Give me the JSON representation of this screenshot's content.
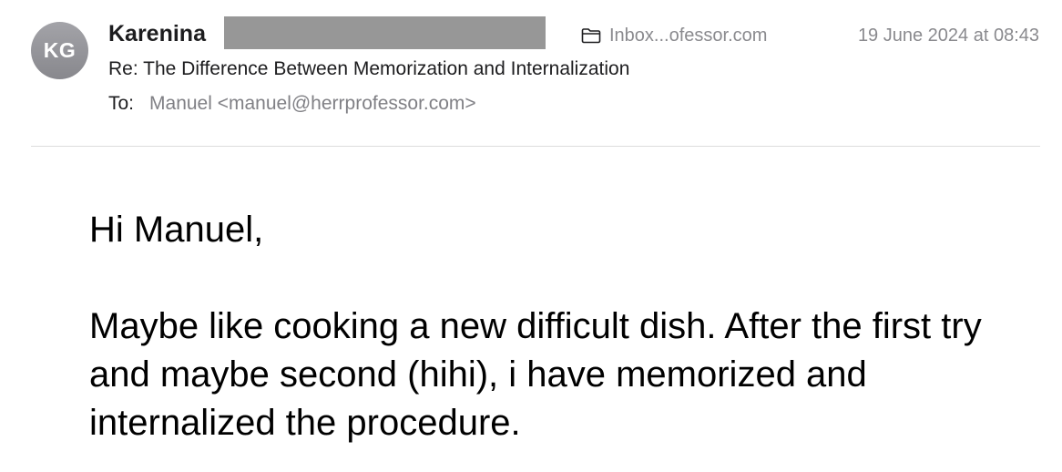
{
  "header": {
    "avatar_initials": "KG",
    "sender_name": "Karenina",
    "mailbox": "Inbox...ofessor.com",
    "mailbox_icon": "folder-icon",
    "date": "19 June 2024 at 08:43",
    "subject": "Re: The Difference Between Memorization and Internalization",
    "to_label": "To:",
    "to_value": "Manuel <manuel@herrprofessor.com>"
  },
  "body": {
    "greeting": "Hi Manuel,",
    "paragraph": "Maybe like cooking a new difficult dish. After the first try and maybe second (hihi), i have memorized and internalized the procedure."
  },
  "colors": {
    "avatar_bg": "#939398",
    "meta_text": "#8a8a8e",
    "redaction": "#979797"
  }
}
